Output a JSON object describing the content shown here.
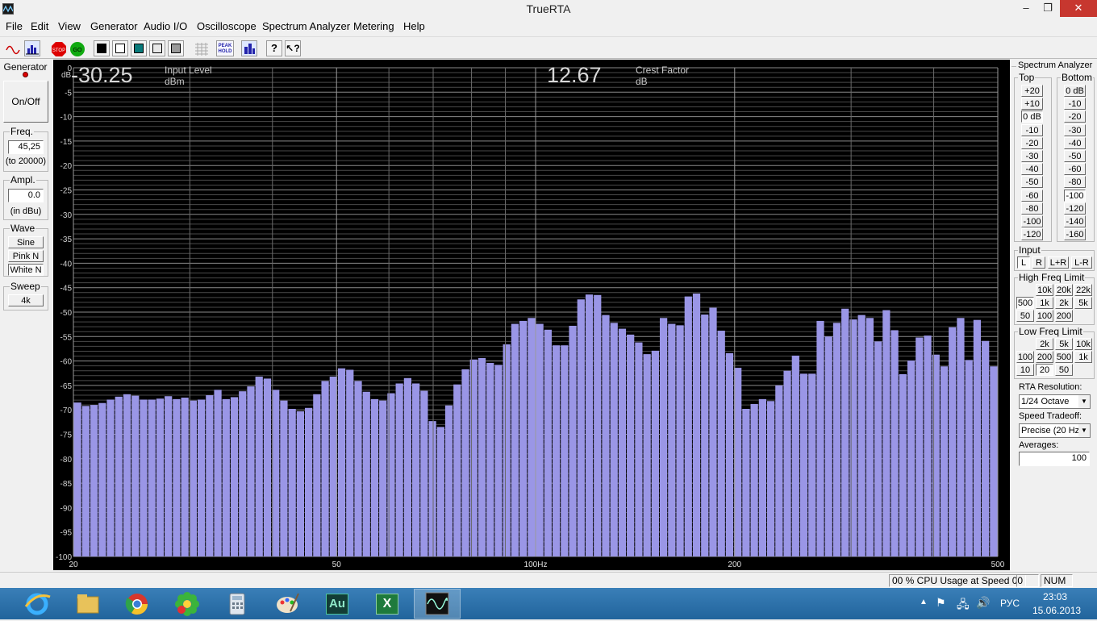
{
  "window": {
    "title": "TrueRTA",
    "minimize": "–",
    "restore": "❐",
    "close": "✕"
  },
  "menu": [
    "File",
    "Edit",
    "View",
    "Generator",
    "Audio I/O",
    "Oscilloscope",
    "Spectrum Analyzer",
    "Metering",
    "Help"
  ],
  "toolbar": {
    "icons": [
      "sine-wave-icon",
      "spectrum-icon",
      "stop-icon",
      "go-icon",
      "black-bg-icon",
      "white-bg-icon",
      "teal-bg-icon",
      "light-gray-icon",
      "gray-icon",
      "grid-icon",
      "peak-hold-icon",
      "bar-mode-icon",
      "help-icon",
      "context-help-icon"
    ],
    "stop_label": "STOP",
    "go_label": "GO",
    "peak_label": "PEAK HOLD"
  },
  "generator": {
    "title": "Generator",
    "onoff": "On/Off",
    "freq_label": "Freq.",
    "freq_value": "45,25",
    "freq_range": "(to 20000)",
    "ampl_label": "Ampl.",
    "ampl_value": "0.0",
    "ampl_unit": "(in dBu)",
    "wave_label": "Wave",
    "wave_options": [
      "Sine",
      "Pink N",
      "White N"
    ],
    "sweep_label": "Sweep",
    "sweep_value": "4k"
  },
  "readouts": {
    "input_level_value": "-30.25",
    "input_level_label": "Input Level",
    "input_level_unit": "dBm",
    "crest_value": "12.67",
    "crest_label": "Crest Factor",
    "crest_unit": "dB"
  },
  "chart_data": {
    "type": "bar",
    "bar_color": "#9a96e6",
    "ylabel": "dB",
    "ylim": [
      -100,
      0
    ],
    "y_ticks": [
      "0",
      "-5",
      "-10",
      "-15",
      "-20",
      "-25",
      "-30",
      "-35",
      "-40",
      "-45",
      "-50",
      "-55",
      "-60",
      "-65",
      "-70",
      "-75",
      "-80",
      "-85",
      "-90",
      "-95",
      "-100"
    ],
    "x_scale": "log",
    "xlim": [
      20,
      500
    ],
    "x_ticks": [
      {
        "v": 20,
        "label": "20"
      },
      {
        "v": 50,
        "label": "50"
      },
      {
        "v": 100,
        "label": "100Hz"
      },
      {
        "v": 200,
        "label": "200"
      },
      {
        "v": 500,
        "label": "500"
      }
    ],
    "grid": true,
    "values": [
      -68.5,
      -69.2,
      -69,
      -68.6,
      -67.9,
      -67.3,
      -66.8,
      -67.1,
      -67.9,
      -67.9,
      -67.7,
      -67.2,
      -67.8,
      -67.5,
      -68.1,
      -67.9,
      -67,
      -65.9,
      -67.8,
      -67.4,
      -66.2,
      -65.2,
      -63.2,
      -63.6,
      -65.9,
      -68.1,
      -69.8,
      -70.3,
      -69.6,
      -66.8,
      -64.1,
      -63.2,
      -61.5,
      -61.8,
      -64.1,
      -66.3,
      -67.8,
      -68.1,
      -66.6,
      -64.6,
      -63.5,
      -64.6,
      -66.1,
      -72.3,
      -73.5,
      -69.1,
      -64.8,
      -61.7,
      -59.7,
      -59.4,
      -60.4,
      -60.8,
      -56.6,
      -52.4,
      -51.8,
      -51.2,
      -52.4,
      -53.6,
      -56.8,
      -56.8,
      -52.8,
      -47.4,
      -46.4,
      -46.5,
      -50.6,
      -52.2,
      -53.4,
      -54.6,
      -56.2,
      -58.6,
      -57.9,
      -51.2,
      -52.4,
      -52.7,
      -46.8,
      -46.2,
      -50.5,
      -49.1,
      -53.8,
      -58.4,
      -61.4,
      -69.8,
      -68.8,
      -67.8,
      -68.2,
      -65,
      -62,
      -58.9,
      -62.6,
      -62.6,
      -51.8,
      -55,
      -52.2,
      -49.3,
      -51.5,
      -50.6,
      -51.2,
      -56,
      -49.6,
      -53.7,
      -62.7,
      -59.9,
      -55.2,
      -54.8,
      -58.7,
      -61.1,
      -53.1,
      -51.2,
      -59.8,
      -51.6,
      -55.9,
      -61.1
    ]
  },
  "spectrum": {
    "title": "Spectrum Analyzer",
    "top_label": "Top",
    "bottom_label": "Bottom",
    "top": [
      "+20",
      "+10",
      "0 dB",
      "-10",
      "-20",
      "-30",
      "-40",
      "-50",
      "-60",
      "-80",
      "-100",
      "-120"
    ],
    "bottom": [
      "0 dB",
      "-10",
      "-20",
      "-30",
      "-40",
      "-50",
      "-60",
      "-80",
      "-100",
      "-120",
      "-140",
      "-160"
    ],
    "top_selected": "0 dB",
    "bottom_selected": "-100",
    "input_label": "Input",
    "input": [
      "L",
      "R",
      "L+R",
      "L-R"
    ],
    "input_selected": "L",
    "high_label": "High Freq Limit",
    "high_rows": [
      [
        "10k",
        "20k",
        "22k"
      ],
      [
        "500",
        "1k",
        "2k",
        "5k"
      ],
      [
        "50",
        "100",
        "200"
      ]
    ],
    "high_selected": "500",
    "low_label": "Low Freq Limit",
    "low_rows": [
      [
        "2k",
        "5k",
        "10k"
      ],
      [
        "100",
        "200",
        "500",
        "1k"
      ],
      [
        "10",
        "20",
        "50"
      ]
    ],
    "low_selected": "20",
    "rta_label": "RTA Resolution:",
    "rta_value": "1/24 Octave",
    "speed_label": "Speed Tradeoff:",
    "speed_value": "Precise (20 Hz",
    "avg_label": "Averages:",
    "avg_value": "100"
  },
  "status": {
    "cpu": "00 % CPU Usage at Speed 00",
    "num": "NUM"
  },
  "taskbar": {
    "apps": [
      "ie-icon",
      "explorer-icon",
      "chrome-icon",
      "icq-icon",
      "calculator-icon",
      "paint-icon",
      "audition-icon",
      "excel-icon",
      "truerta-icon"
    ],
    "audition_label": "Au",
    "excel_label": "X",
    "lang": "РУС",
    "time": "23:03",
    "date": "15.06.2013"
  },
  "colors": {
    "plot_bg": "#000000",
    "grid": "#7a7a7a",
    "bars": "#9a96e6"
  }
}
